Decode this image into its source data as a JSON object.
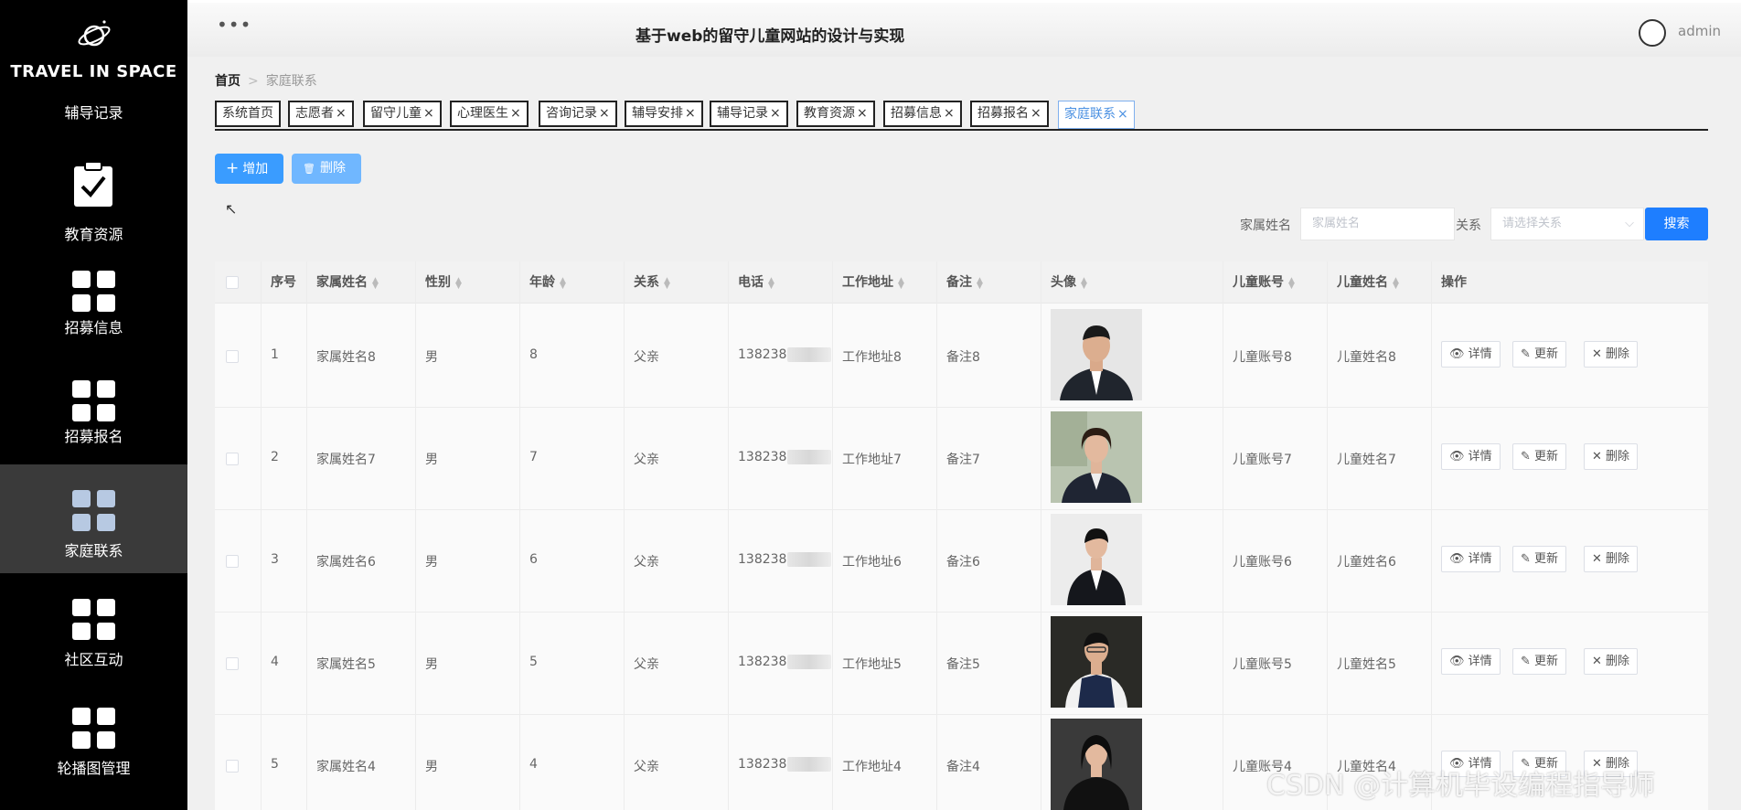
{
  "app": {
    "logo_text": "TRAVEL IN SPACE",
    "title": "基于web的留守儿童网站的设计与实现",
    "user": "admin"
  },
  "sidebar": {
    "items": [
      {
        "label": "辅导记录",
        "icon": "none"
      },
      {
        "label": "教育资源",
        "icon": "clipboard-check-icon"
      },
      {
        "label": "招募信息",
        "icon": "grid-icon"
      },
      {
        "label": "招募报名",
        "icon": "grid-icon"
      },
      {
        "label": "家庭联系",
        "icon": "grid-icon",
        "active": true
      },
      {
        "label": "社区互动",
        "icon": "grid-icon"
      },
      {
        "label": "轮播图管理",
        "icon": "grid-icon"
      }
    ]
  },
  "breadcrumb": {
    "home": "首页",
    "current": "家庭联系"
  },
  "tabs": [
    {
      "label": "系统首页",
      "closable": false
    },
    {
      "label": "志愿者",
      "closable": true
    },
    {
      "label": "留守儿童",
      "closable": true
    },
    {
      "label": "心理医生",
      "closable": true
    },
    {
      "label": "咨询记录",
      "closable": true
    },
    {
      "label": "辅导安排",
      "closable": true
    },
    {
      "label": "辅导记录",
      "closable": true
    },
    {
      "label": "教育资源",
      "closable": true
    },
    {
      "label": "招募信息",
      "closable": true
    },
    {
      "label": "招募报名",
      "closable": true
    },
    {
      "label": "家庭联系",
      "closable": true,
      "active": true
    }
  ],
  "toolbar": {
    "add_label": "增加",
    "delete_label": "删除"
  },
  "search": {
    "name_label": "家属姓名",
    "name_placeholder": "家属姓名",
    "relation_label": "关系",
    "relation_placeholder": "请选择关系",
    "button_label": "搜索"
  },
  "table": {
    "columns": [
      "序号",
      "家属姓名",
      "性别",
      "年龄",
      "关系",
      "电话",
      "工作地址",
      "备注",
      "头像",
      "儿童账号",
      "儿童姓名",
      "操作"
    ],
    "rows": [
      {
        "index": "1",
        "name": "家属姓名8",
        "gender": "男",
        "age": "8",
        "relation": "父亲",
        "phone": "138238",
        "address": "工作地址8",
        "remark": "备注8",
        "child_account": "儿童账号8",
        "child_name": "儿童姓名8"
      },
      {
        "index": "2",
        "name": "家属姓名7",
        "gender": "男",
        "age": "7",
        "relation": "父亲",
        "phone": "138238",
        "address": "工作地址7",
        "remark": "备注7",
        "child_account": "儿童账号7",
        "child_name": "儿童姓名7"
      },
      {
        "index": "3",
        "name": "家属姓名6",
        "gender": "男",
        "age": "6",
        "relation": "父亲",
        "phone": "138238",
        "address": "工作地址6",
        "remark": "备注6",
        "child_account": "儿童账号6",
        "child_name": "儿童姓名6"
      },
      {
        "index": "4",
        "name": "家属姓名5",
        "gender": "男",
        "age": "5",
        "relation": "父亲",
        "phone": "138238",
        "address": "工作地址5",
        "remark": "备注5",
        "child_account": "儿童账号5",
        "child_name": "儿童姓名5"
      },
      {
        "index": "5",
        "name": "家属姓名4",
        "gender": "男",
        "age": "4",
        "relation": "父亲",
        "phone": "138238",
        "address": "工作地址4",
        "remark": "备注4",
        "child_account": "儿童账号4",
        "child_name": "儿童姓名4"
      }
    ],
    "actions": {
      "detail": "详情",
      "update": "更新",
      "delete": "删除"
    }
  },
  "watermark": "CSDN @计算机毕设编程指导师"
}
